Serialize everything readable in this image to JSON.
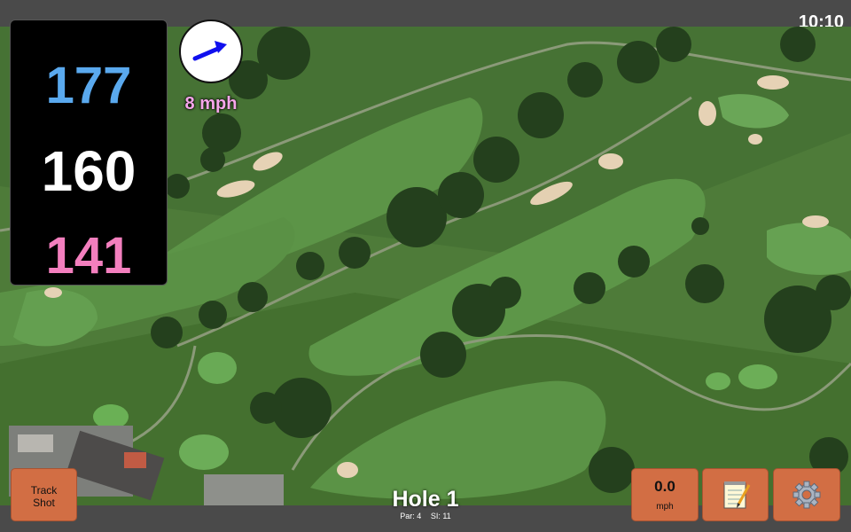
{
  "status": {
    "time": "10:10"
  },
  "yardages": {
    "back": "177",
    "middle": "160",
    "front": "141"
  },
  "wind": {
    "speed": "8 mph",
    "icon": "arrow-icon"
  },
  "hole": {
    "title": "Hole 1",
    "par": "Par: 4",
    "si": "SI: 11"
  },
  "buttons": {
    "track_shot": "Track Shot",
    "speed_value": "0.0",
    "speed_unit": "mph",
    "notes_icon": "notepad-icon",
    "settings_icon": "gear-icon"
  },
  "colors": {
    "back": "#5aa9ee",
    "middle": "#ffffff",
    "front": "#f37fbe",
    "button": "#d26e44"
  }
}
